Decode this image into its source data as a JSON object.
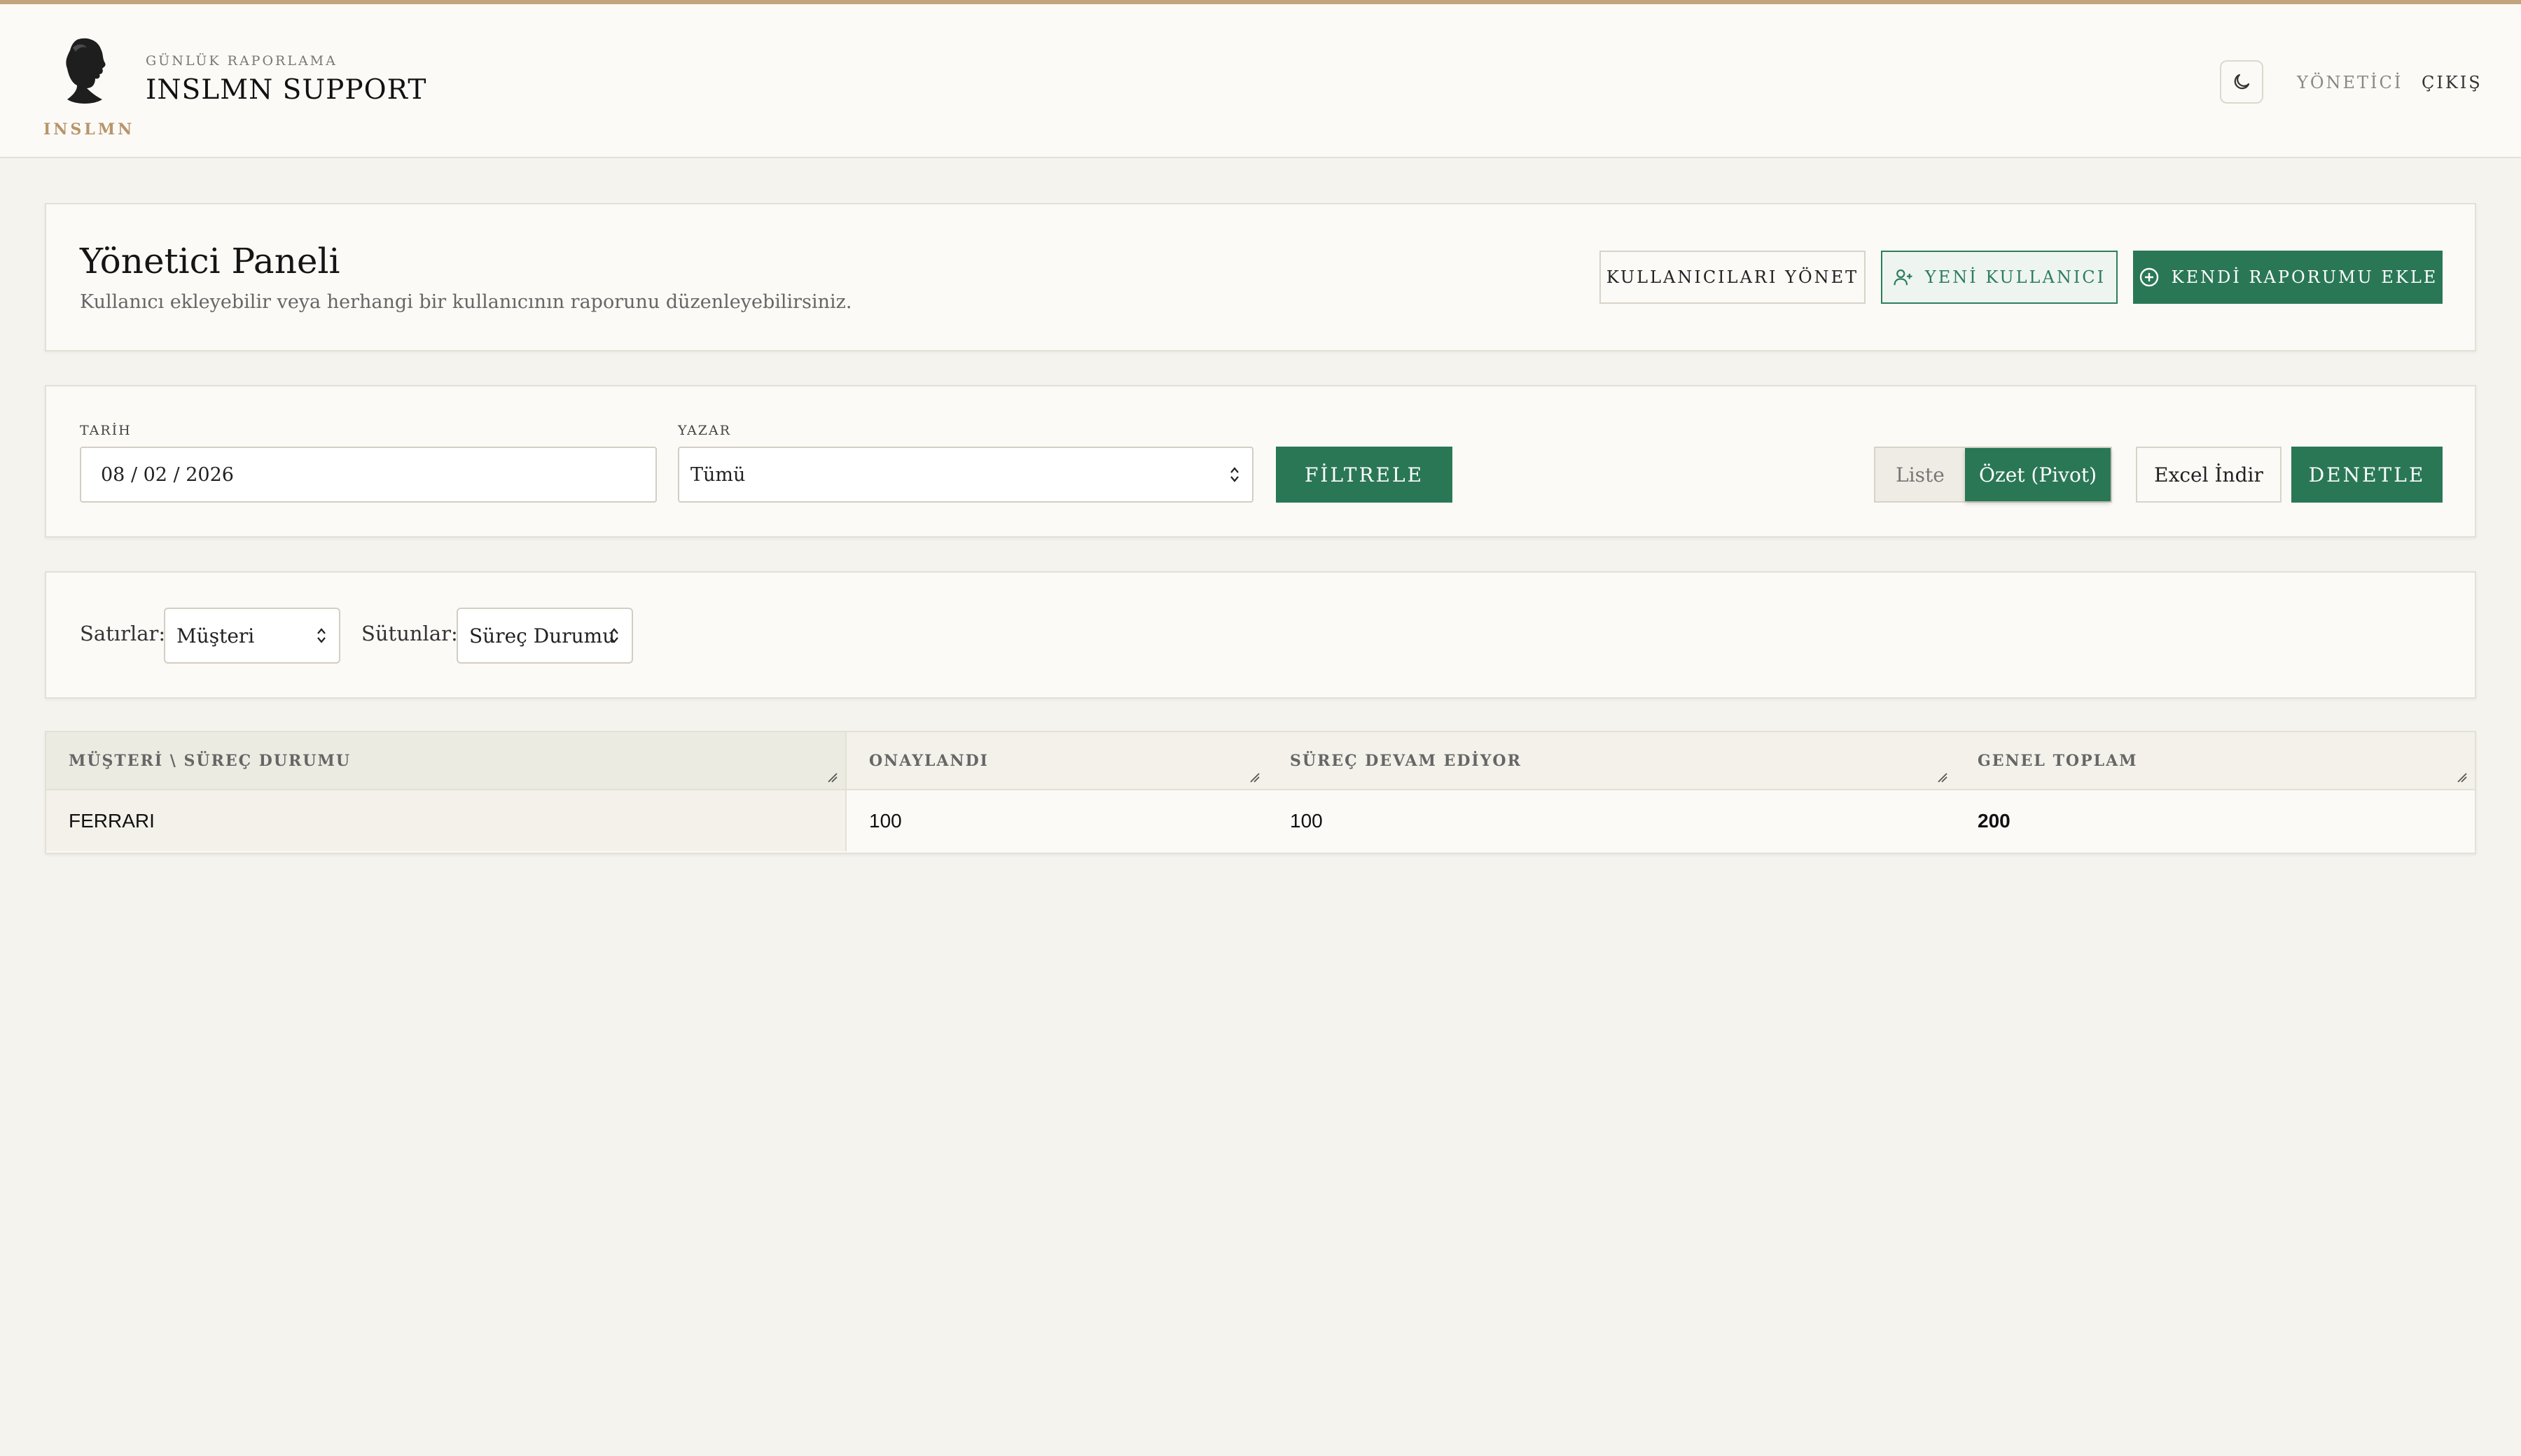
{
  "header": {
    "logo_text": "INSLMN",
    "brand_sub": "GÜNLÜK RAPORLAMA",
    "brand_title": "INSLMN SUPPORT",
    "nav_admin": "YÖNETİCİ",
    "nav_logout": "ÇIKIŞ"
  },
  "admin_panel": {
    "title": "Yönetici Paneli",
    "subtitle": "Kullanıcı ekleyebilir veya herhangi bir kullanıcının raporunu düzenleyebilirsiniz.",
    "manage_users_label": "KULLANICILARI YÖNET",
    "new_user_label": "YENİ KULLANICI",
    "add_report_label": "KENDİ RAPORUMU EKLE"
  },
  "filters": {
    "date_label": "TARİH",
    "date_value": "08 / 02 / 2026",
    "author_label": "YAZAR",
    "author_value": "Tümü",
    "filter_label": "FİLTRELE",
    "view_list": "Liste",
    "view_pivot": "Özet (Pivot)",
    "excel_label": "Excel İndir",
    "audit_label": "DENETLE"
  },
  "pivot_config": {
    "rows_label": "Satırlar:",
    "rows_value": "Müşteri",
    "cols_label": "Sütunlar:",
    "cols_value": "Süreç Durumu"
  },
  "table": {
    "headers": [
      "MÜŞTERİ \\ SÜREÇ DURUMU",
      "ONAYLANDI",
      "SÜREÇ DEVAM EDİYOR",
      "GENEL TOPLAM"
    ],
    "rows": [
      [
        "FERRARI",
        "100",
        "100",
        "200"
      ]
    ]
  },
  "colors": {
    "accent_green": "#2a7756",
    "gold": "#c2a57c",
    "background": "#f5f3ee"
  }
}
